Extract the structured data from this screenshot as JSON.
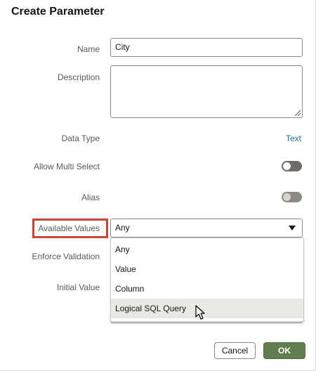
{
  "dialog": {
    "title": "Create Parameter"
  },
  "fields": {
    "name_label": "Name",
    "name_value": "City",
    "description_label": "Description",
    "description_value": "",
    "data_type_label": "Data Type",
    "data_type_value": "Text",
    "allow_multi_select_label": "Allow Multi Select",
    "allow_multi_select_on": false,
    "alias_label": "Alias",
    "alias_on": false,
    "available_values_label": "Available Values",
    "available_values_selected": "Any",
    "enforce_validation_label": "Enforce Validation",
    "initial_value_label": "Initial Value"
  },
  "dropdown": {
    "options": [
      "Any",
      "Value",
      "Column",
      "Logical SQL Query"
    ],
    "hovered": "Logical SQL Query"
  },
  "buttons": {
    "cancel_label": "Cancel",
    "ok_label": "OK"
  },
  "colors": {
    "highlight": "#c74634",
    "ok_button": "#5f7d4f",
    "link": "#1f6d94"
  },
  "icons": {
    "caret": "caret-down-icon",
    "resize": "resize-handle-icon",
    "cursor": "mouse-pointer-icon"
  }
}
